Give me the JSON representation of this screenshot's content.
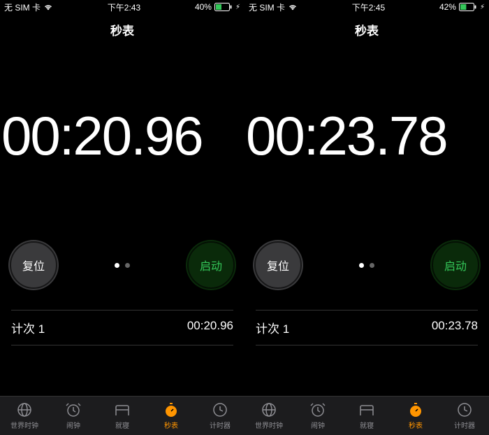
{
  "screens": [
    {
      "statusbar": {
        "carrier": "无 SIM 卡",
        "time": "下午2:43",
        "battery_pct": "40%"
      },
      "header_title": "秒表",
      "stopwatch_time": "00:20.96",
      "reset_label": "复位",
      "start_label": "启动",
      "lap_label": "计次 1",
      "lap_time": "00:20.96",
      "tabs": {
        "world_clock": "世界时钟",
        "alarm": "闹钟",
        "bedtime": "就寝",
        "stopwatch": "秒表",
        "timer": "计时器"
      }
    },
    {
      "statusbar": {
        "carrier": "无 SIM 卡",
        "time": "下午2:45",
        "battery_pct": "42%"
      },
      "header_title": "秒表",
      "stopwatch_time": "00:23.78",
      "reset_label": "复位",
      "start_label": "启动",
      "lap_label": "计次 1",
      "lap_time": "00:23.78",
      "tabs": {
        "world_clock": "世界时钟",
        "alarm": "闹钟",
        "bedtime": "就寝",
        "stopwatch": "秒表",
        "timer": "计时器"
      }
    }
  ]
}
